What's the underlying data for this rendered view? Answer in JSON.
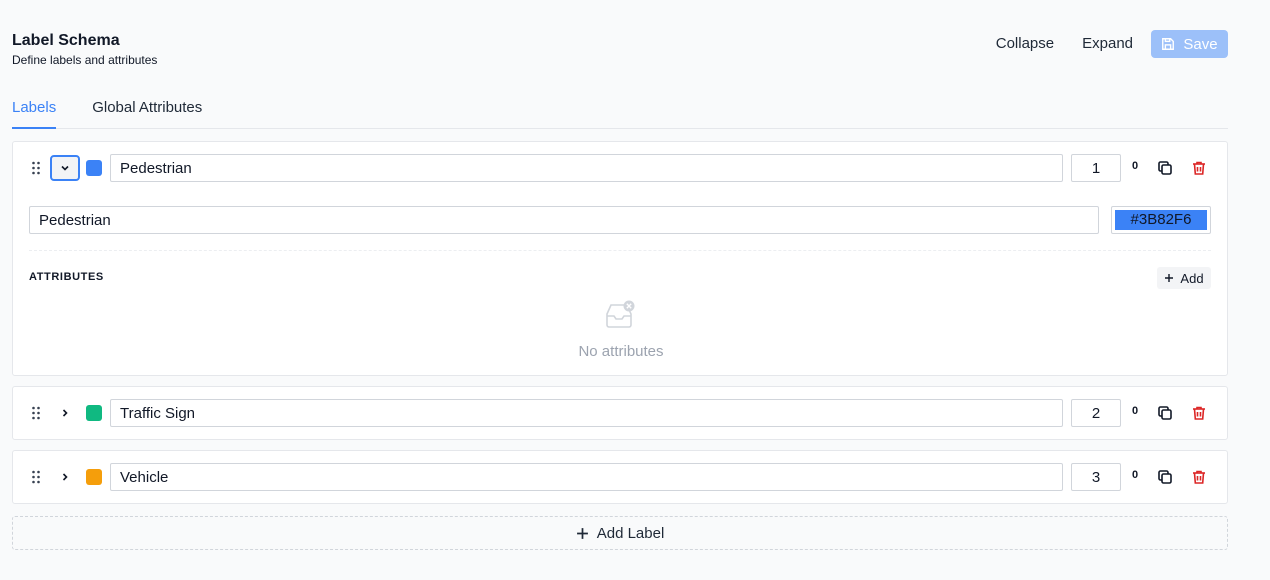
{
  "header": {
    "title": "Label Schema",
    "subtitle": "Define labels and attributes",
    "collapse_label": "Collapse",
    "expand_label": "Expand",
    "save_label": "Save"
  },
  "tabs": [
    {
      "label": "Labels",
      "active": true
    },
    {
      "label": "Global Attributes",
      "active": false
    }
  ],
  "labels": [
    {
      "name": "Pedestrian",
      "color": "#3B82F6",
      "id": "1",
      "attr_count": "0",
      "expanded": true,
      "display_name": "Pedestrian",
      "color_value": "#3B82F6"
    },
    {
      "name": "Traffic Sign",
      "color": "#10B981",
      "id": "2",
      "attr_count": "0",
      "expanded": false
    },
    {
      "name": "Vehicle",
      "color": "#F59E0B",
      "id": "3",
      "attr_count": "0",
      "expanded": false
    }
  ],
  "attributes": {
    "heading": "ATTRIBUTES",
    "add_label": "Add",
    "empty_text": "No attributes"
  },
  "footer": {
    "add_label_text": "Add Label"
  },
  "colors": {
    "accent": "#3B82F6",
    "danger": "#DC2626",
    "save_disabled": "#9CC0F9"
  },
  "icons": {
    "drag": "drag-handle-icon",
    "chevron_down": "chevron-down-icon",
    "chevron_right": "chevron-right-icon",
    "copy": "copy-icon",
    "trash": "trash-icon",
    "save": "save-icon",
    "plus": "plus-icon",
    "empty": "empty-inbox-icon"
  }
}
